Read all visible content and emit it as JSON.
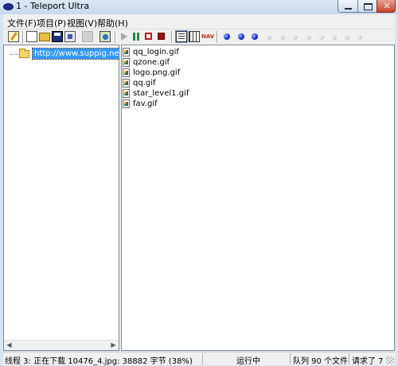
{
  "window": {
    "title": "1 - Teleport Ultra",
    "close_glyph": "✕"
  },
  "menu": {
    "items": [
      "文件(F)",
      "项目(P)",
      "视图(V)",
      "帮助(H)"
    ]
  },
  "toolbar": {
    "icons": [
      "new-project",
      "new",
      "open",
      "save",
      "properties",
      "cut",
      "browse",
      "start",
      "pause",
      "stop-after",
      "stop",
      "details-view",
      "list-view",
      "navigate"
    ],
    "nav_icon_text": "NAV",
    "connection_balls": [
      "active",
      "active",
      "active",
      "idle",
      "idle",
      "idle",
      "idle",
      "idle",
      "idle",
      "idle",
      "idle"
    ],
    "colors": {
      "active_ball": "#0b2ac8",
      "idle_ball": "#c8c8c8"
    }
  },
  "tree": {
    "root_label": "http://www.suppig.net/forum"
  },
  "files": [
    "qq_login.gif",
    "qzone.gif",
    "logo.png.gif",
    "qq.gif",
    "star_level1.gif",
    "fav.gif"
  ],
  "status": {
    "thread": "线程 3: 正在下载 10476_4.jpg: 38882 字节 (38%)",
    "state": "运行中",
    "queue": "队列 90 个文件",
    "requested": "请求了 7"
  }
}
